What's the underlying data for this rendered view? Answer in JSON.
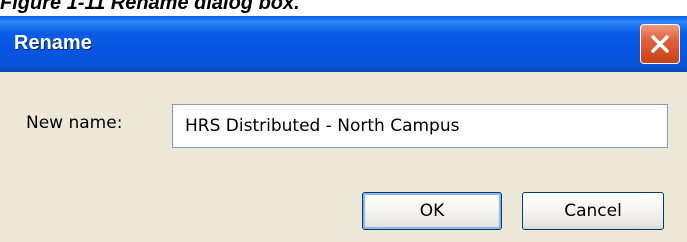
{
  "caption": "Figure 1-11 Rename dialog box.",
  "dialog": {
    "title": "Rename",
    "close_icon": "close-icon",
    "label": "New name:",
    "name_value": "HRS Distributed - North Campus",
    "ok_label": "OK",
    "cancel_label": "Cancel"
  },
  "colors": {
    "titlebar": "#0554e2",
    "close_button": "#e0603a",
    "dialog_background": "#ece9d8"
  }
}
